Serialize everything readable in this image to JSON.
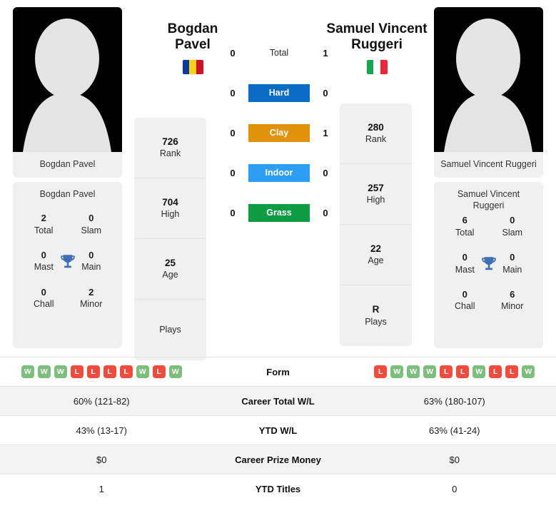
{
  "players": {
    "left": {
      "first_name": "Bogdan",
      "last_name": "Pavel",
      "full_name": "Bogdan Pavel",
      "country_flag": "romania-flag",
      "flag_colors": [
        "#0a3b9b",
        "#fcd116",
        "#ce1126"
      ],
      "photo_caption": "Bogdan Pavel",
      "info": [
        {
          "value": "726",
          "label": "Rank"
        },
        {
          "value": "704",
          "label": "High"
        },
        {
          "value": "25",
          "label": "Age"
        },
        {
          "value": "",
          "label": "Plays"
        }
      ],
      "titles": [
        {
          "value": "2",
          "label": "Total"
        },
        {
          "value": "0",
          "label": "Slam"
        },
        {
          "value": "0",
          "label": "Mast"
        },
        {
          "value": "0",
          "label": "Main"
        },
        {
          "value": "0",
          "label": "Chall"
        },
        {
          "value": "2",
          "label": "Minor"
        }
      ],
      "form": [
        "W",
        "W",
        "W",
        "L",
        "L",
        "L",
        "L",
        "W",
        "L",
        "W"
      ],
      "career_total_wl": "60% (121-82)",
      "ytd_wl": "43% (13-17)",
      "career_prize_money": "$0",
      "ytd_titles": "1"
    },
    "right": {
      "first_name": "Samuel Vincent",
      "last_name": "Ruggeri",
      "full_name": "Samuel Vincent Ruggeri",
      "country_flag": "italy-flag",
      "flag_colors": [
        "#14a750",
        "#ffffff",
        "#e8293a"
      ],
      "photo_caption": "Samuel Vincent Ruggeri",
      "info": [
        {
          "value": "280",
          "label": "Rank"
        },
        {
          "value": "257",
          "label": "High"
        },
        {
          "value": "22",
          "label": "Age"
        },
        {
          "value": "R",
          "label": "Plays"
        }
      ],
      "titles": [
        {
          "value": "6",
          "label": "Total"
        },
        {
          "value": "0",
          "label": "Slam"
        },
        {
          "value": "0",
          "label": "Mast"
        },
        {
          "value": "0",
          "label": "Main"
        },
        {
          "value": "0",
          "label": "Chall"
        },
        {
          "value": "6",
          "label": "Minor"
        }
      ],
      "form": [
        "L",
        "W",
        "W",
        "W",
        "L",
        "L",
        "W",
        "L",
        "L",
        "W"
      ],
      "career_total_wl": "63% (180-107)",
      "ytd_wl": "63% (41-24)",
      "career_prize_money": "$0",
      "ytd_titles": "0"
    }
  },
  "head_to_head": [
    {
      "surface": "Total",
      "left": "0",
      "right": "1",
      "color": "transparent",
      "text_color": "#2b2b2b"
    },
    {
      "surface": "Hard",
      "left": "0",
      "right": "0",
      "color": "#0a6cc4",
      "text_color": "#ffffff"
    },
    {
      "surface": "Clay",
      "left": "0",
      "right": "1",
      "color": "#e09208",
      "text_color": "#ffffff"
    },
    {
      "surface": "Indoor",
      "left": "0",
      "right": "0",
      "color": "#2e9ef4",
      "text_color": "#ffffff"
    },
    {
      "surface": "Grass",
      "left": "0",
      "right": "0",
      "color": "#0e9b42",
      "text_color": "#ffffff"
    }
  ],
  "comparison": {
    "rows": [
      {
        "label": "Form",
        "type": "form"
      },
      {
        "label": "Career Total W/L",
        "type": "text",
        "key": "career_total_wl"
      },
      {
        "label": "YTD W/L",
        "type": "text",
        "key": "ytd_wl"
      },
      {
        "label": "Career Prize Money",
        "type": "text",
        "key": "career_prize_money"
      },
      {
        "label": "YTD Titles",
        "type": "text",
        "key": "ytd_titles"
      }
    ]
  },
  "theme": {
    "card_bg": "#f0f0f0",
    "row_alt_bg": "#f3f3f3",
    "win_color": "#7cbe7c",
    "loss_color": "#ef4c3e",
    "trophy_color": "#3f6fb5"
  }
}
